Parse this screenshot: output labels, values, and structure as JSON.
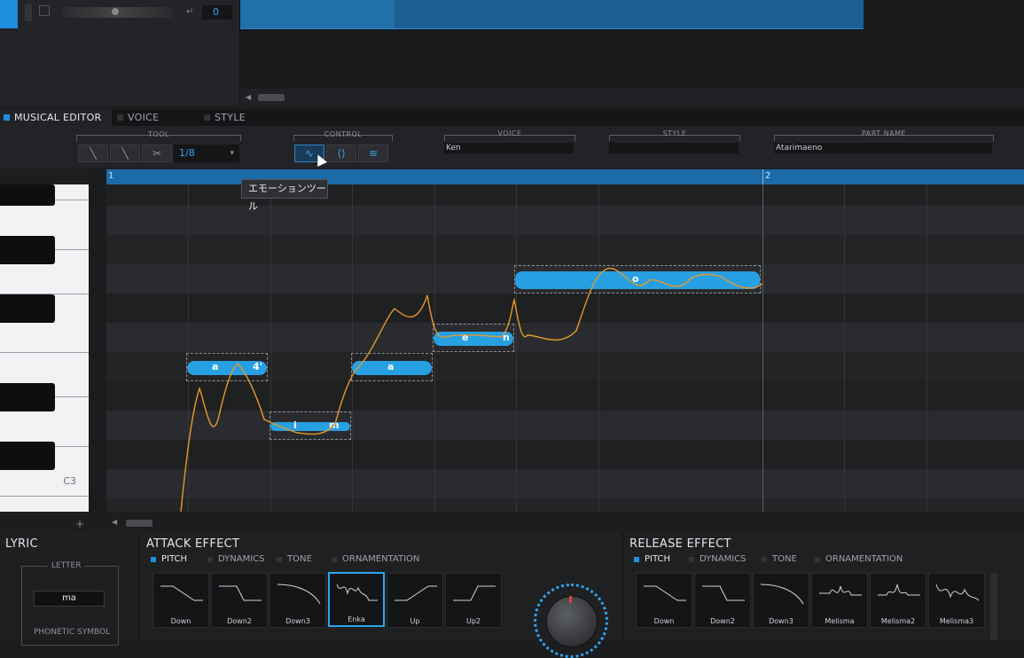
{
  "transport": {
    "value": "0"
  },
  "tabs": [
    {
      "label": "MUSICAL EDITOR",
      "active": true
    },
    {
      "label": "VOICE",
      "active": false
    },
    {
      "label": "STYLE",
      "active": false
    }
  ],
  "toolbar": {
    "tool_label": "TOOL",
    "quantize": "1/8",
    "control_label": "CONTROL",
    "voice_label": "VOICE",
    "voice_value": "Ken",
    "style_label": "STYLE",
    "style_value": "",
    "part_name_label": "PART NAME",
    "part_name_value": "Atarimaeno"
  },
  "tooltip": "エモーションツール",
  "ruler": {
    "bar1": "1",
    "bar2": "2"
  },
  "keyboard": {
    "c3_label": "C3"
  },
  "notes": [
    {
      "lyric": "a",
      "suffix": "4'"
    },
    {
      "lyric": "i",
      "suffix": "m"
    },
    {
      "lyric": "a",
      "suffix": ""
    },
    {
      "lyric": "e",
      "suffix": "n"
    },
    {
      "lyric": "o",
      "suffix": ""
    }
  ],
  "lyric_panel": {
    "title": "LYRIC",
    "letter_label": "LETTER",
    "letter_value": "ma",
    "phonetic_label": "PHONETIC SYMBOL"
  },
  "attack": {
    "title": "ATTACK EFFECT",
    "tabs": [
      "PITCH",
      "DYNAMICS",
      "TONE",
      "ORNAMENTATION"
    ],
    "effects": [
      "Down",
      "Down2",
      "Down3",
      "Enka",
      "Up",
      "Up2"
    ],
    "selected": "Enka"
  },
  "release": {
    "title": "RELEASE EFFECT",
    "tabs": [
      "PITCH",
      "DYNAMICS",
      "TONE",
      "ORNAMENTATION"
    ],
    "effects": [
      "Down",
      "Down2",
      "Down3",
      "Melisma",
      "Melisma2",
      "Melisma3"
    ]
  },
  "colors": {
    "accent": "#1e90e0",
    "wave": "#27a0e3",
    "pitch_curve": "#e39a2a"
  },
  "icons": {
    "tool_1": "pencil-icon",
    "tool_2": "line-icon",
    "tool_3": "scissors-icon",
    "control_1": "emotion-tool-icon",
    "control_2": "vibrato-icon",
    "control_3": "dynamics-icon"
  }
}
